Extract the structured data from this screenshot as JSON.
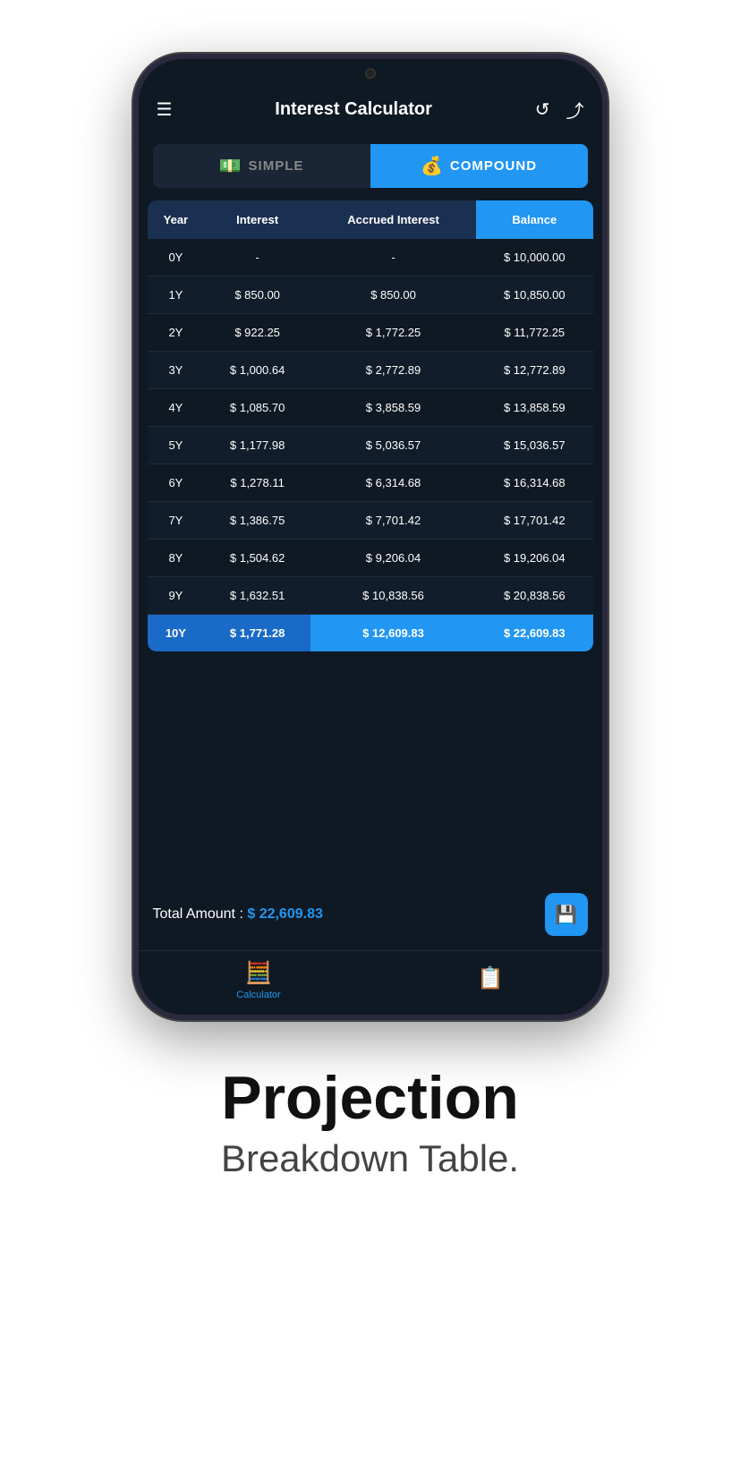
{
  "header": {
    "title": "Interest Calculator",
    "menu_icon": "☰",
    "refresh_icon": "↺",
    "share_icon": "⤴"
  },
  "tabs": {
    "simple_label": "SIMPLE",
    "compound_label": "COMPOUND",
    "simple_icon": "💵",
    "compound_icon": "💰"
  },
  "table": {
    "headers": [
      "Year",
      "Interest",
      "Accrued Interest",
      "Balance"
    ],
    "rows": [
      {
        "year": "0Y",
        "interest": "-",
        "accrued": "-",
        "balance": "$ 10,000.00"
      },
      {
        "year": "1Y",
        "interest": "$ 850.00",
        "accrued": "$ 850.00",
        "balance": "$ 10,850.00"
      },
      {
        "year": "2Y",
        "interest": "$ 922.25",
        "accrued": "$ 1,772.25",
        "balance": "$ 11,772.25"
      },
      {
        "year": "3Y",
        "interest": "$ 1,000.64",
        "accrued": "$ 2,772.89",
        "balance": "$ 12,772.89"
      },
      {
        "year": "4Y",
        "interest": "$ 1,085.70",
        "accrued": "$ 3,858.59",
        "balance": "$ 13,858.59"
      },
      {
        "year": "5Y",
        "interest": "$ 1,177.98",
        "accrued": "$ 5,036.57",
        "balance": "$ 15,036.57"
      },
      {
        "year": "6Y",
        "interest": "$ 1,278.11",
        "accrued": "$ 6,314.68",
        "balance": "$ 16,314.68"
      },
      {
        "year": "7Y",
        "interest": "$ 1,386.75",
        "accrued": "$ 7,701.42",
        "balance": "$ 17,701.42"
      },
      {
        "year": "8Y",
        "interest": "$ 1,504.62",
        "accrued": "$ 9,206.04",
        "balance": "$ 19,206.04"
      },
      {
        "year": "9Y",
        "interest": "$ 1,632.51",
        "accrued": "$ 10,838.56",
        "balance": "$ 20,838.56"
      },
      {
        "year": "10Y",
        "interest": "$ 1,771.28",
        "accrued": "$ 12,609.83",
        "balance": "$ 22,609.83"
      }
    ]
  },
  "total": {
    "label": "Total Amount :",
    "amount": "$ 22,609.83"
  },
  "nav": {
    "calculator_label": "Calculator",
    "history_label": ""
  },
  "footer": {
    "heading": "Projection",
    "subheading": "Breakdown Table."
  }
}
